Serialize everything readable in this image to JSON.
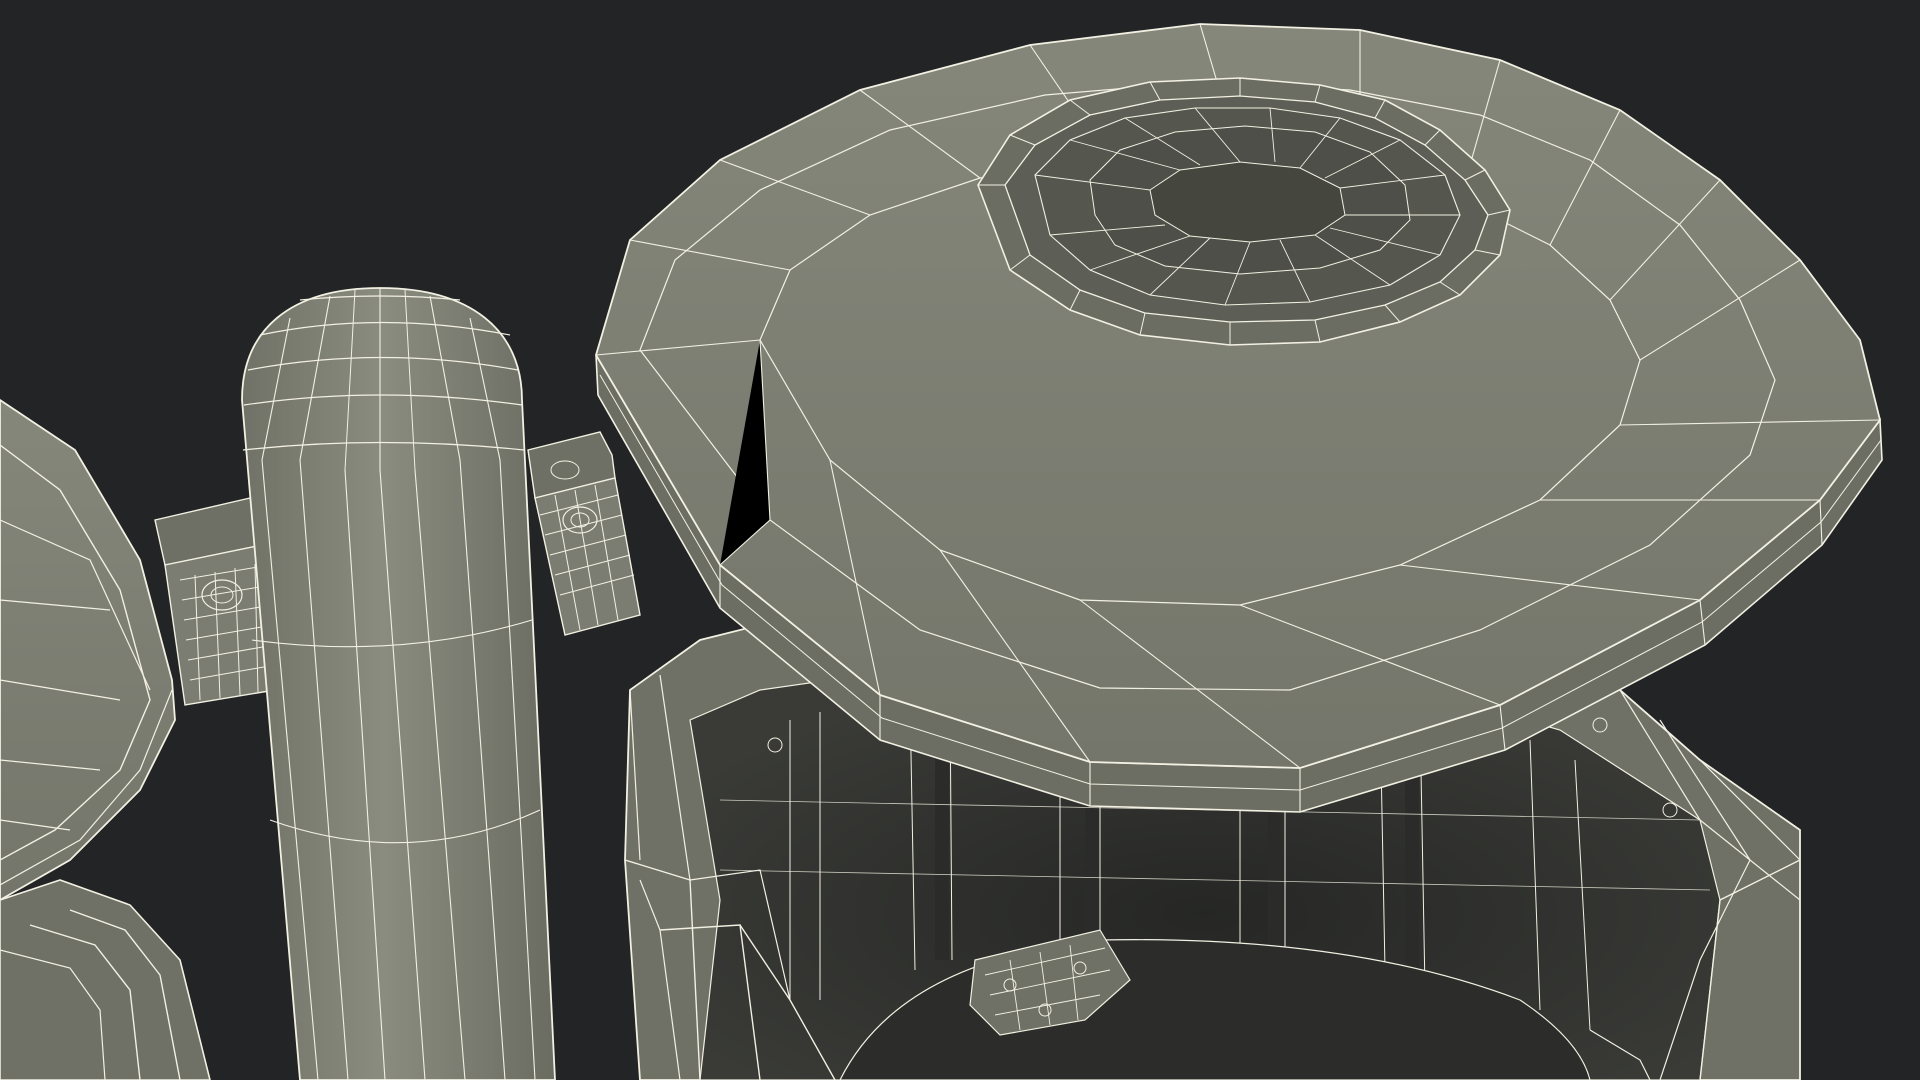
{
  "scene": {
    "background_color": "#232425",
    "surface_color": "#7b7d72",
    "surface_shade_color": "#5f6157",
    "interior_color": "#3a3b37",
    "interior_dark_color": "#2b2c2a",
    "wire_color": "#f2f0e2",
    "objects": [
      "left-bin-lid",
      "left-bin-body",
      "center-post",
      "post-mount-bracket-left",
      "post-mount-bracket-right",
      "right-bin-lid",
      "right-bin-lid-opening",
      "right-bin-body",
      "right-bin-interior-bracket"
    ]
  }
}
